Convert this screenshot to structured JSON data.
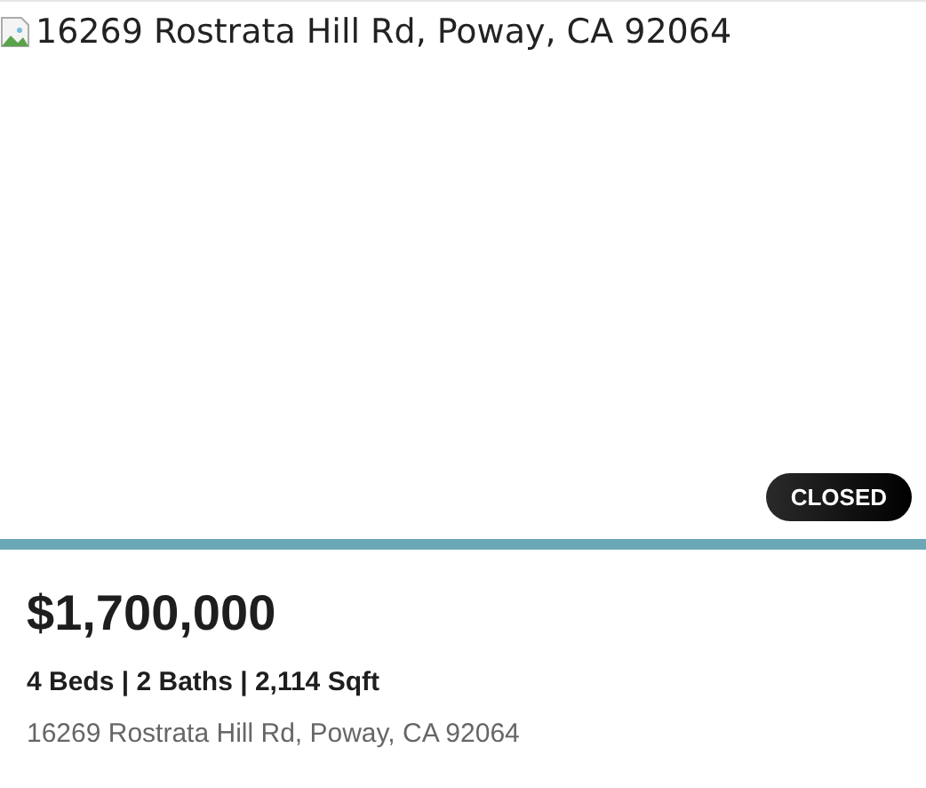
{
  "image": {
    "alt": "16269 Rostrata Hill Rd, Poway, CA 92064"
  },
  "status_badge": "CLOSED",
  "price": "$1,700,000",
  "details": "4 Beds | 2 Baths | 2,114 Sqft",
  "address": "16269 Rostrata Hill Rd, Poway, CA 92064"
}
